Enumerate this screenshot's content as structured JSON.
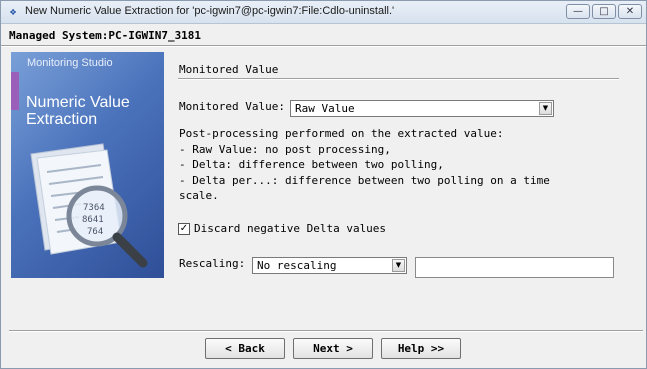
{
  "window": {
    "title": "New Numeric Value Extraction for 'pc-igwin7@pc-igwin7:File:Cdlo-uninstall.'",
    "icon": "app-icon",
    "controls": {
      "minimize": "—",
      "maximize": "□",
      "close": "✕"
    }
  },
  "system_line": "Managed System:PC-IGWIN7_3181",
  "side_panel": {
    "studio": "Monitoring Studio",
    "heading": "Numeric Value Extraction",
    "art_numbers": [
      "7364",
      "8641",
      "764"
    ]
  },
  "section_title": "Monitored Value",
  "monitored_value": {
    "label": "Monitored Value:",
    "selected": "Raw Value"
  },
  "description": [
    "Post-processing performed on the extracted value:",
    " - Raw Value: no post processing,",
    " - Delta: difference between two polling,",
    " - Delta per...: difference between two polling on a time",
    "   scale."
  ],
  "discard_negative": {
    "label": "Discard negative Delta values",
    "checked": true,
    "mark": "✓"
  },
  "rescaling": {
    "label": "Rescaling:",
    "selected": "No rescaling",
    "value": ""
  },
  "buttons": {
    "back": "< Back",
    "next": "Next >",
    "help": "Help >>"
  }
}
